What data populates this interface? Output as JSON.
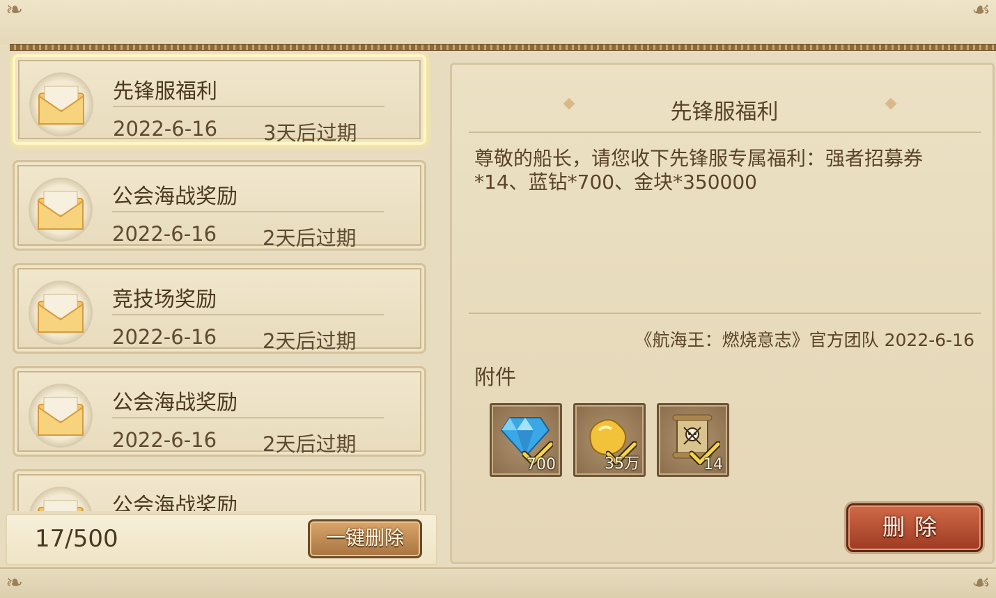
{
  "mails": [
    {
      "title": "先锋服福利",
      "date": "2022-6-16",
      "expire": "3天后过期",
      "selected": true
    },
    {
      "title": "公会海战奖励",
      "date": "2022-6-16",
      "expire": "2天后过期",
      "selected": false
    },
    {
      "title": "竞技场奖励",
      "date": "2022-6-16",
      "expire": "2天后过期",
      "selected": false
    },
    {
      "title": "公会海战奖励",
      "date": "2022-6-16",
      "expire": "2天后过期",
      "selected": false
    },
    {
      "title": "公会海战奖励",
      "date": "",
      "expire": "",
      "selected": false
    }
  ],
  "footer": {
    "count": "17/500",
    "delete_all_label": "一键删除"
  },
  "detail": {
    "title": "先锋服福利",
    "body": "尊敬的船长，请您收下先锋服专属福利：强者招募券*14、蓝钻*700、金块*350000",
    "signature": "《航海王：燃烧意志》官方团队  2022-6-16",
    "attachments_label": "附件",
    "attachments": [
      {
        "icon": "blue-diamond-icon",
        "qty": "700",
        "claimed": true
      },
      {
        "icon": "gold-nugget-icon",
        "qty": "35万",
        "claimed": true
      },
      {
        "icon": "recruit-scroll-icon",
        "qty": "14",
        "claimed": true
      }
    ],
    "delete_label": "删除"
  }
}
